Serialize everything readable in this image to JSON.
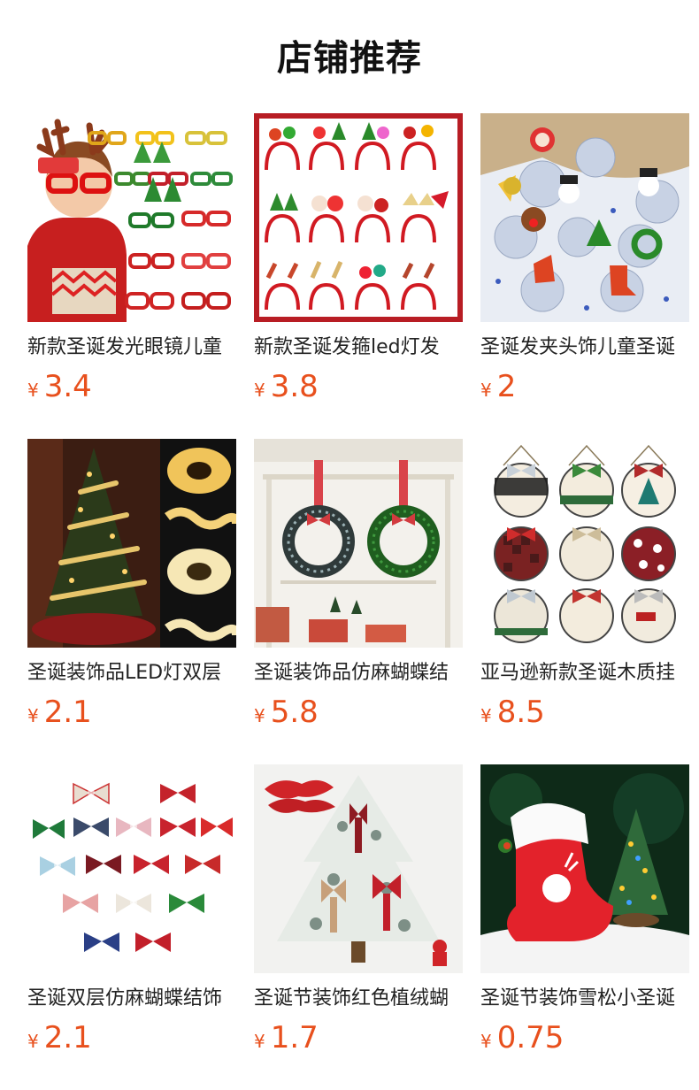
{
  "section": {
    "title": "店铺推荐"
  },
  "currency_symbol": "¥",
  "products": [
    {
      "name": "新款圣诞发光眼镜儿童",
      "price": "3.4",
      "image": "light-up-christmas-glasses-product-photo"
    },
    {
      "name": "新款圣诞发箍led灯发",
      "price": "3.8",
      "image": "christmas-headbands-product-photo"
    },
    {
      "name": "圣诞发夹头饰儿童圣诞",
      "price": "2",
      "image": "christmas-hair-clips-product-photo"
    },
    {
      "name": "圣诞装饰品LED灯双层",
      "price": "2.1",
      "image": "led-ribbon-christmas-tree-product-photo"
    },
    {
      "name": "圣诞装饰品仿麻蝴蝶结",
      "price": "5.8",
      "image": "christmas-wreath-bow-product-photo"
    },
    {
      "name": "亚马逊新款圣诞木质挂",
      "price": "8.5",
      "image": "wooden-christmas-door-signs-product-photo"
    },
    {
      "name": "圣诞双层仿麻蝴蝶结饰",
      "price": "2.1",
      "image": "christmas-bows-product-photo"
    },
    {
      "name": "圣诞节装饰红色植绒蝴",
      "price": "1.7",
      "image": "flocked-christmas-tree-bows-product-photo"
    },
    {
      "name": "圣诞节装饰雪松小圣诞",
      "price": "0.75",
      "image": "snow-pine-mini-tree-stocking-product-photo"
    }
  ]
}
